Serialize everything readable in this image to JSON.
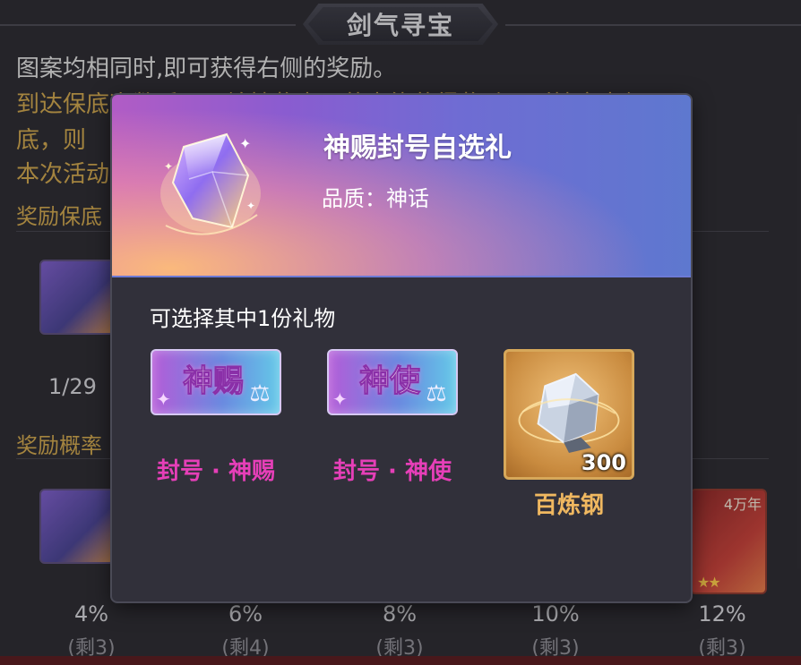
{
  "page": {
    "title": "剑气寻宝",
    "rule_lines": [
      "图案均相同时,即可获得右侧的奖励。",
      "到达保底次数后再一轮抽奖中，若未能获得奖励，则抽命中保",
      "底，则",
      "本次活动"
    ],
    "reward_guarantee_label": "奖励保底",
    "guarantee_progress": "1/29",
    "reward_probability_label": "奖励概率",
    "probabilities": [
      "4%",
      "6%",
      "8%",
      "10%",
      "12%"
    ],
    "probability_subs": [
      "(剩3)",
      "(剩4)",
      "(剩3)",
      "(剩3)",
      "(剩3)"
    ],
    "last_item_badge": "4万年",
    "last_item_stars": "★★"
  },
  "modal": {
    "gift_name": "神赐封号自选礼",
    "quality": "品质：神话",
    "choose_prompt": "可选择其中1份礼物",
    "options": [
      {
        "card_text": "神赐",
        "label": "封号 · 神赐",
        "icon": "scales-icon"
      },
      {
        "card_text": "神使",
        "label": "封号 · 神使",
        "icon": "scales-icon"
      },
      {
        "quantity": "300",
        "label": "百炼钢",
        "icon": "steel-ore-icon"
      }
    ]
  },
  "colors": {
    "accent_gold": "#c9a24d",
    "title_magenta": "#e63fb8",
    "steel_label": "#f0b860"
  }
}
